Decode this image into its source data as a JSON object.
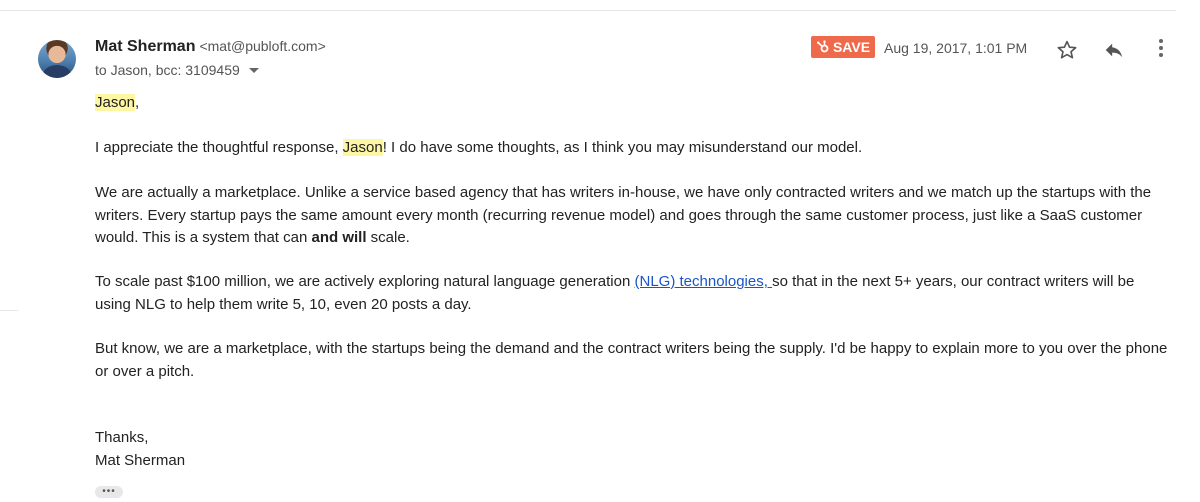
{
  "header": {
    "sender_name": "Mat Sherman",
    "sender_email": "<mat@publoft.com>",
    "recipients": "to Jason, bcc: 3109459",
    "save_label": "SAVE",
    "date": "Aug 19, 2017, 1:01 PM"
  },
  "body": {
    "greeting_name": "Jason",
    "greeting_punct": ",",
    "p1_before": "I appreciate the thoughtful response, ",
    "p1_name": "Jason",
    "p1_after": "! I do have some thoughts, as I think you may misunderstand our model.",
    "p2_text": "We are actually a marketplace. Unlike a service based agency that has writers in-house, we have only contracted writers and we match up the startups with the writers. Every startup pays the same amount every month (recurring revenue model) and goes through the same customer process, just like a SaaS customer would. This is a system that can ",
    "p2_bold": "and will",
    "p2_end": " scale.",
    "p3_before": "To scale past $100 million, we are actively exploring natural language generation ",
    "p3_link": "(NLG) technologies, ",
    "p3_after": "so that in the next 5+ years, our contract writers will be using  NLG to help them write 5, 10, even 20 posts a day.",
    "p4_text": "But know, we are a marketplace, with the startups being the demand and the contract writers being the supply. I'd be happy to explain more to you over the phone or over a pitch.",
    "signoff": "Thanks,",
    "signature": "Mat Sherman"
  },
  "trimmed_label": "•••",
  "colors": {
    "save_bg": "#ef6a4a",
    "highlight": "#fdf6a3",
    "link": "#1a55c7"
  },
  "icons": {
    "save": "hubspot-sprocket-icon",
    "star": "star-outline-icon",
    "reply": "reply-arrow-icon",
    "more": "vertical-dots-icon",
    "expand": "caret-down-icon"
  }
}
